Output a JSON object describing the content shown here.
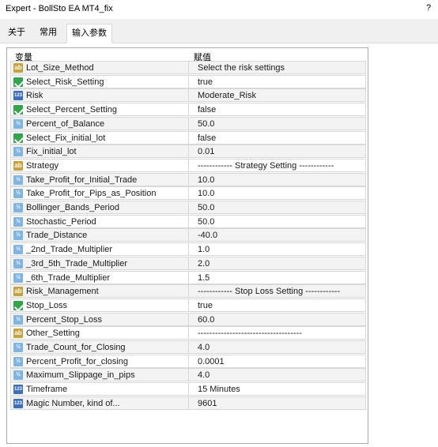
{
  "window": {
    "title": "Expert - BollSto EA MT4_fix",
    "help": "?"
  },
  "tabs": [
    {
      "label": "关于",
      "active": false
    },
    {
      "label": "常用",
      "active": false
    },
    {
      "label": "输入参数",
      "active": true
    }
  ],
  "table": {
    "headers": {
      "variable": "变量",
      "value": "赋值"
    },
    "rows": [
      {
        "name": "Lot_Size_Method",
        "value": "Select the risk settings",
        "type": "ab"
      },
      {
        "name": "Select_Risk_Setting",
        "value": "true",
        "type": "bool"
      },
      {
        "name": "Risk",
        "value": "Moderate_Risk",
        "type": "num"
      },
      {
        "name": "Select_Percent_Setting",
        "value": "false",
        "type": "bool"
      },
      {
        "name": "Percent_of_Balance",
        "value": "50.0",
        "type": "real"
      },
      {
        "name": "Select_Fix_initial_lot",
        "value": "false",
        "type": "bool"
      },
      {
        "name": "Fix_initial_lot",
        "value": "0.01",
        "type": "real"
      },
      {
        "name": "Strategy",
        "value": "------------ Strategy Setting ------------",
        "type": "ab"
      },
      {
        "name": "Take_Profit_for_Initial_Trade",
        "value": "10.0",
        "type": "real"
      },
      {
        "name": "Take_Profit_for_Pips_as_Position",
        "value": "10.0",
        "type": "real"
      },
      {
        "name": "Bollinger_Bands_Period",
        "value": "50.0",
        "type": "real"
      },
      {
        "name": "Stochastic_Period",
        "value": "50.0",
        "type": "real"
      },
      {
        "name": "Trade_Distance",
        "value": "-40.0",
        "type": "real"
      },
      {
        "name": "_2nd_Trade_Multiplier",
        "value": "1.0",
        "type": "real"
      },
      {
        "name": "_3rd_5th_Trade_Multiplier",
        "value": "2.0",
        "type": "real"
      },
      {
        "name": "_6th_Trade_Multiplier",
        "value": "1.5",
        "type": "real"
      },
      {
        "name": "Risk_Management",
        "value": "------------ Stop Loss Setting ------------",
        "type": "ab"
      },
      {
        "name": "Stop_Loss",
        "value": "true",
        "type": "bool"
      },
      {
        "name": "Percent_Stop_Loss",
        "value": "60.0",
        "type": "real"
      },
      {
        "name": "Other_Setting",
        "value": "------------------------------------",
        "type": "ab"
      },
      {
        "name": "Trade_Count_for_Closing",
        "value": "4.0",
        "type": "real"
      },
      {
        "name": "Percent_Profit_for_closing",
        "value": "0.0001",
        "type": "real"
      },
      {
        "name": "Maximum_Slippage_in_pips",
        "value": "4.0",
        "type": "real"
      },
      {
        "name": "Timeframe",
        "value": "15 Minutes",
        "type": "num"
      },
      {
        "name": "Magic Number, kind of...",
        "value": "9601",
        "type": "num"
      }
    ]
  },
  "icons": {
    "ab": "string-icon",
    "bool": "bool-icon",
    "num": "enum-icon",
    "real": "double-icon"
  },
  "icon_text": {
    "ab": "ab",
    "num": "123",
    "real": "½"
  },
  "colors": {
    "ab": "#c8a23a",
    "bool": "#2fa84a",
    "num": "#3a6fc4",
    "real": "#7fb4e6"
  }
}
